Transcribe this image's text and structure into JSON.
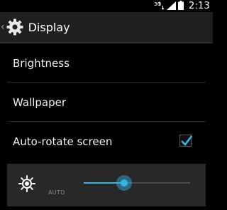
{
  "status_bar": {
    "network_type": "3G",
    "time": "2:13"
  },
  "action_bar": {
    "title": "Display",
    "icon": "gear-icon"
  },
  "settings_list": [
    {
      "label": "Brightness"
    },
    {
      "label": "Wallpaper"
    },
    {
      "label": "Auto-rotate screen",
      "checked": true
    }
  ],
  "brightness_dialog": {
    "auto_label": "AUTO",
    "level_percent": 38
  },
  "colors": {
    "accent": "#33b5e5",
    "action_bar": "#1e1f21",
    "panel": "#282828",
    "background": "#000000"
  }
}
